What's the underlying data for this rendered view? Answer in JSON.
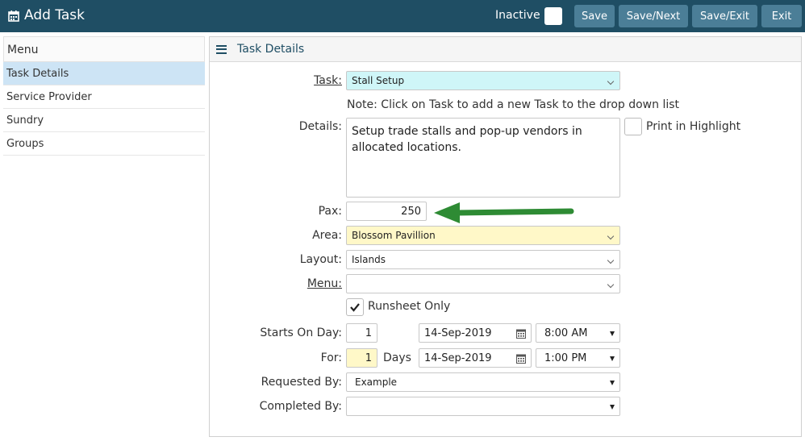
{
  "header": {
    "title": "Add Task",
    "inactive_label": "Inactive",
    "buttons": {
      "save": "Save",
      "save_next": "Save/Next",
      "save_exit": "Save/Exit",
      "exit": "Exit"
    }
  },
  "sidebar": {
    "heading": "Menu",
    "items": [
      {
        "label": "Task Details"
      },
      {
        "label": "Service Provider"
      },
      {
        "label": "Sundry"
      },
      {
        "label": "Groups"
      }
    ]
  },
  "panel": {
    "title": "Task Details",
    "task": {
      "label": "Task:",
      "value": "Stall Setup"
    },
    "note": "Note: Click on Task to add a new Task to the drop down list",
    "details": {
      "label": "Details:",
      "value": "Setup trade stalls and pop-up vendors in allocated locations."
    },
    "print_highlight": "Print in Highlight",
    "pax": {
      "label": "Pax:",
      "value": "250"
    },
    "area": {
      "label": "Area:",
      "value": "Blossom Pavillion"
    },
    "layout": {
      "label": "Layout:",
      "value": "Islands"
    },
    "menu": {
      "label": "Menu:",
      "value": ""
    },
    "runsheet_only": "Runsheet Only",
    "starts_on_day": {
      "label": "Starts On Day:",
      "day": "1",
      "date": "14-Sep-2019",
      "time": "8:00 AM"
    },
    "for": {
      "label": "For:",
      "days": "1",
      "days_label": "Days",
      "date": "14-Sep-2019",
      "time": "1:00 PM"
    },
    "requested_by": {
      "label": "Requested By:",
      "value": "Example"
    },
    "completed_by": {
      "label": "Completed By:",
      "value": ""
    }
  },
  "colors": {
    "header_bg": "#1f4e64",
    "button_bg": "#4b7e97",
    "task_bg": "#cff6f8",
    "area_bg": "#fff8c8",
    "arrow": "#2e8b34"
  }
}
